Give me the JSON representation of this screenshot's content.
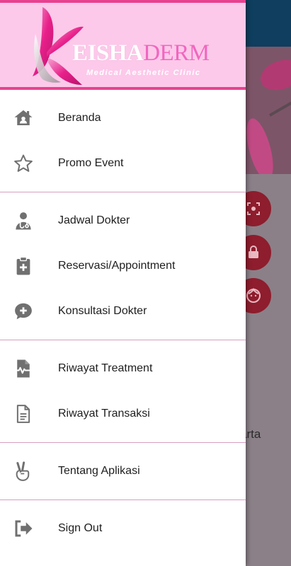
{
  "brand": {
    "name_part1": "EISHA",
    "name_part2": "DERM",
    "tagline": "Medical Aesthetic Clinic",
    "colors": {
      "header_bg": "#fcc9ea",
      "accent": "#e8428f"
    }
  },
  "menu": {
    "groups": [
      {
        "items": [
          {
            "label": "Beranda",
            "icon": "home-icon"
          },
          {
            "label": "Promo Event",
            "icon": "star-outline-icon"
          }
        ]
      },
      {
        "items": [
          {
            "label": "Jadwal Dokter",
            "icon": "doctor-icon"
          },
          {
            "label": "Reservasi/Appointment",
            "icon": "clipboard-plus-icon"
          },
          {
            "label": "Konsultasi Dokter",
            "icon": "chat-plus-icon"
          }
        ]
      },
      {
        "items": [
          {
            "label": "Riwayat Treatment",
            "icon": "file-pulse-icon"
          },
          {
            "label": "Riwayat Transaksi",
            "icon": "file-document-icon"
          }
        ]
      },
      {
        "items": [
          {
            "label": "Tentang Aplikasi",
            "icon": "peace-hand-icon"
          }
        ]
      },
      {
        "items": [
          {
            "label": "Sign Out",
            "icon": "sign-out-icon"
          }
        ]
      }
    ]
  },
  "background": {
    "partial_text": "arta"
  }
}
